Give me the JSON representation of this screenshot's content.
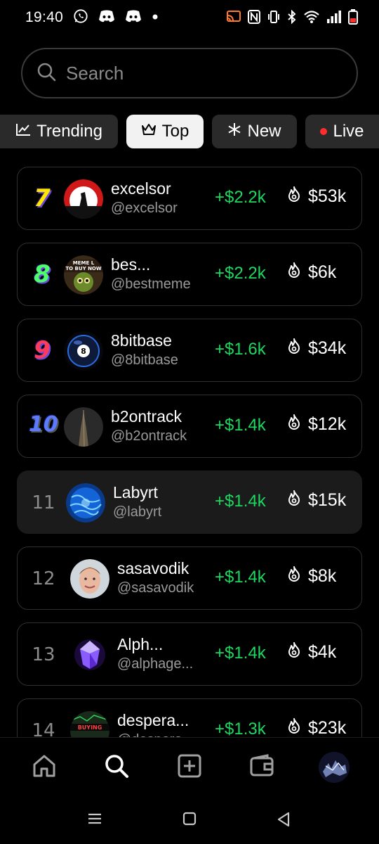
{
  "status_bar": {
    "time": "19:40",
    "left_icons": [
      "whatsapp-icon",
      "discord-icon",
      "discord-icon",
      "dot-icon"
    ],
    "right_icons": [
      "cast-icon",
      "nfc-icon",
      "vibrate-icon",
      "bluetooth-icon",
      "wifi-icon",
      "signal-icon",
      "battery-icon"
    ]
  },
  "search": {
    "placeholder": "Search",
    "value": ""
  },
  "tabs": [
    {
      "label": "Trending",
      "icon": "chart-icon",
      "active": false
    },
    {
      "label": "Top",
      "icon": "crown-icon",
      "active": true
    },
    {
      "label": "New",
      "icon": "asterisk-icon",
      "active": false
    },
    {
      "label": "Live",
      "icon": "live-dot",
      "active": false
    }
  ],
  "rows": [
    {
      "rank": "7",
      "name": "excelsor",
      "handle": "@excelsor",
      "gain": "+$2.2k",
      "market_cap": "$53k"
    },
    {
      "rank": "8",
      "name": "bes...",
      "handle": "@bestmeme",
      "gain": "+$2.2k",
      "market_cap": "$6k"
    },
    {
      "rank": "9",
      "name": "8bitbase",
      "handle": "@8bitbase",
      "gain": "+$1.6k",
      "market_cap": "$34k"
    },
    {
      "rank": "10",
      "name": "b2ontrack",
      "handle": "@b2ontrack",
      "gain": "+$1.4k",
      "market_cap": "$12k"
    },
    {
      "rank": "11",
      "name": "Labyrt",
      "handle": "@labyrt",
      "gain": "+$1.4k",
      "market_cap": "$15k"
    },
    {
      "rank": "12",
      "name": "sasavodik",
      "handle": "@sasavodik",
      "gain": "+$1.4k",
      "market_cap": "$8k"
    },
    {
      "rank": "13",
      "name": "Alph...",
      "handle": "@alphage...",
      "gain": "+$1.4k",
      "market_cap": "$4k"
    },
    {
      "rank": "14",
      "name": "despera...",
      "handle": "@despera...",
      "gain": "+$1.3k",
      "market_cap": "$23k"
    }
  ],
  "avatar_texts": {
    "bestmeme": "MEME L\nTO BUY NOW",
    "desperado": "BUYING\nTHE DIP"
  },
  "bottom_nav": [
    "home-icon",
    "search-icon",
    "create-icon",
    "wallet-icon",
    "profile-avatar"
  ],
  "system_nav": [
    "recents-icon",
    "home-button-icon",
    "back-icon"
  ],
  "colors": {
    "gain": "#1ed760",
    "live": "#ff2d2d",
    "active_tab": "#f2f2f2"
  }
}
